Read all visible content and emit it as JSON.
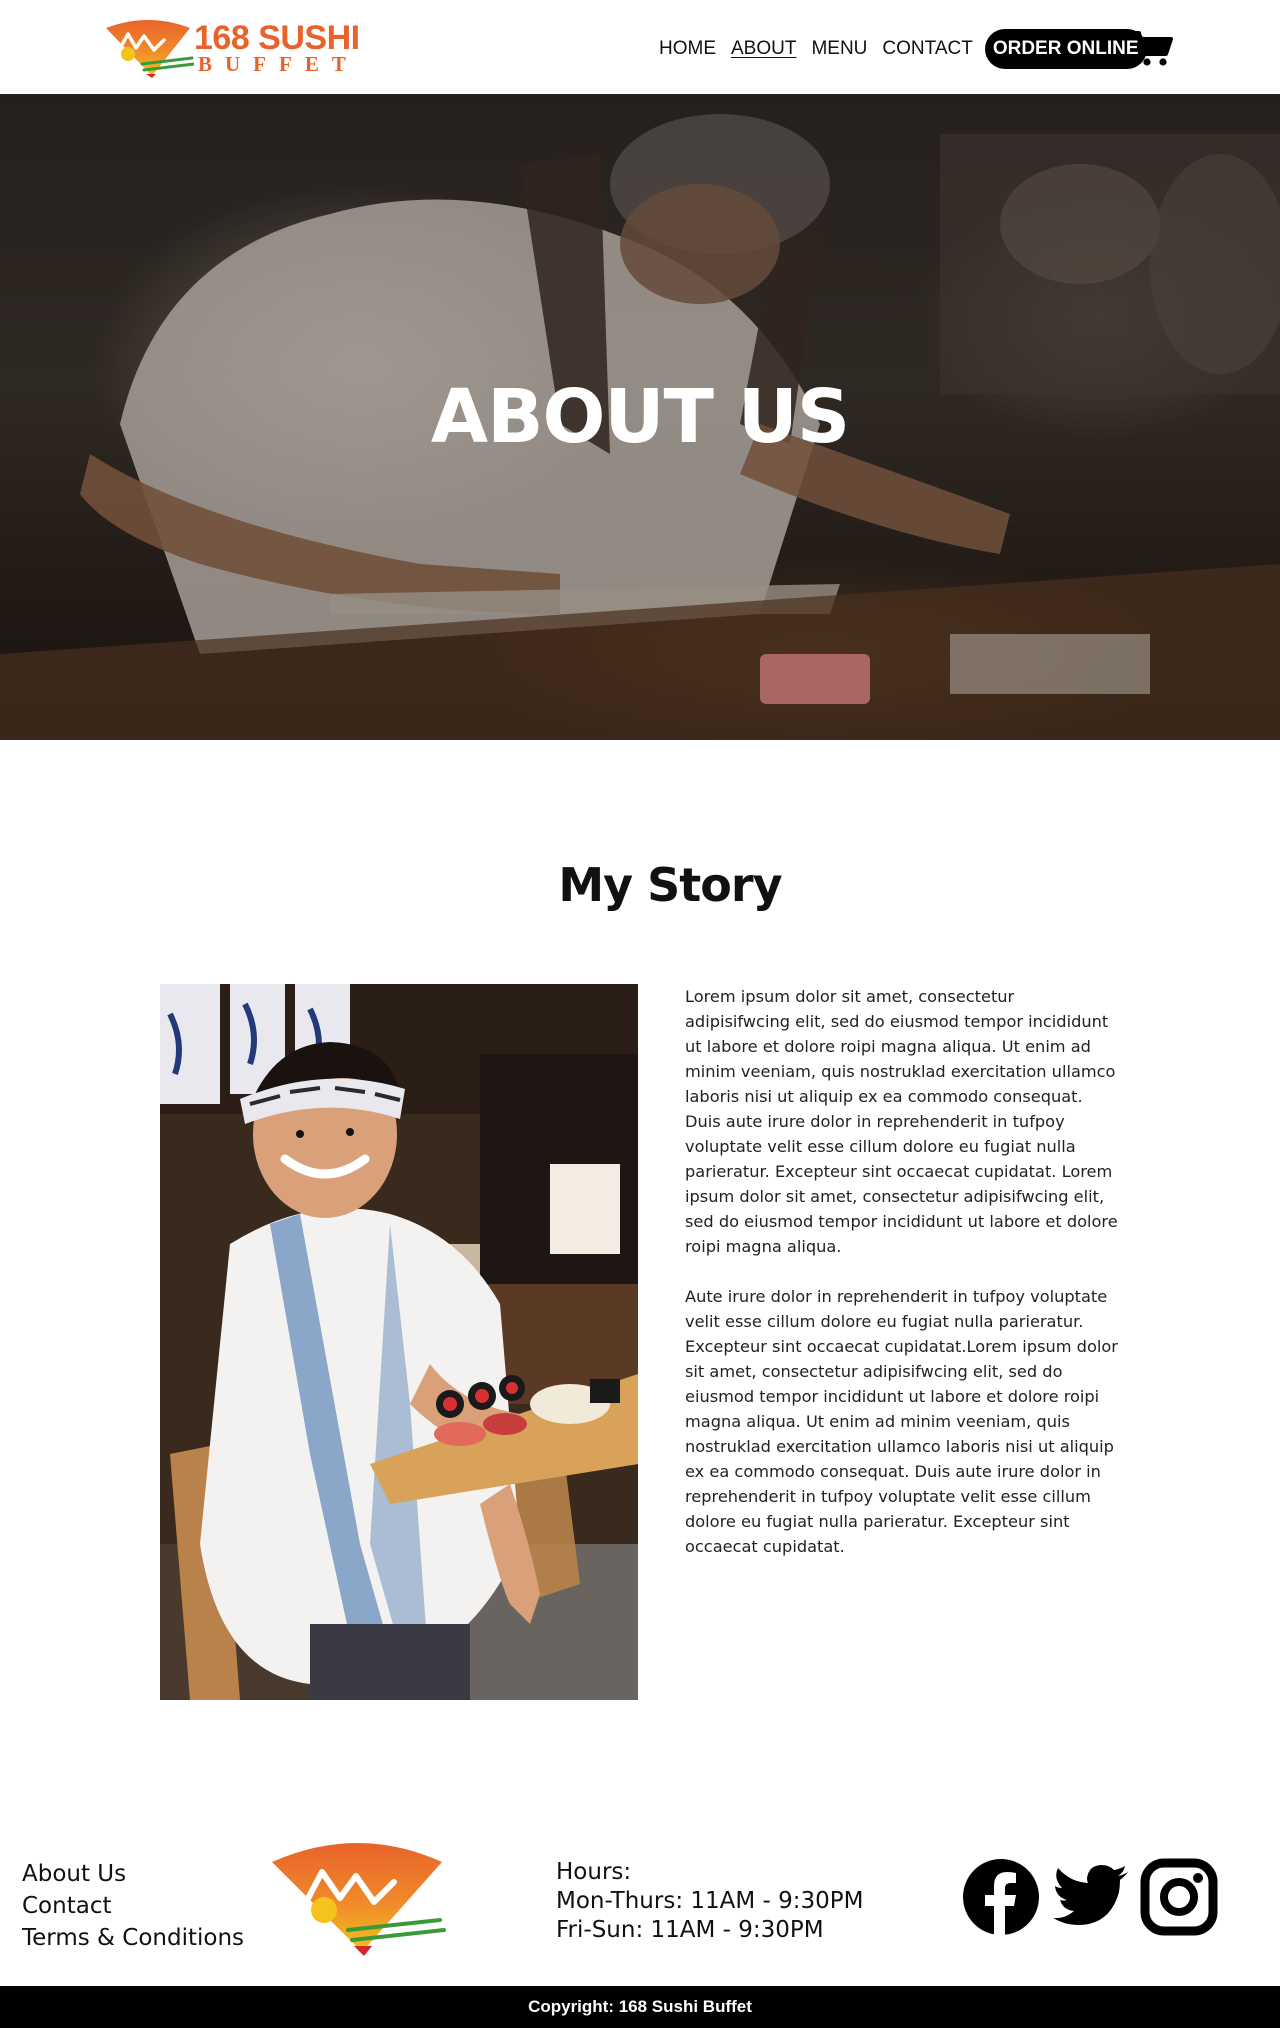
{
  "brand": {
    "name_line1": "168 SUSHI",
    "name_line2": "BUFFET",
    "orange": "#e8632a",
    "yellow": "#f6c21c"
  },
  "nav": {
    "items": [
      {
        "label": "HOME",
        "active": false
      },
      {
        "label": "ABOUT",
        "active": true
      },
      {
        "label": "MENU",
        "active": false
      },
      {
        "label": "CONTACT",
        "active": false
      }
    ],
    "order_label": "ORDER ONLINE",
    "cart_icon": "shopping-cart-icon"
  },
  "hero": {
    "title": "ABOUT US"
  },
  "story": {
    "heading": "My Story",
    "paragraphs": [
      "Lorem ipsum dolor sit amet, consectetur adipisifwcing elit, sed do eiusmod tempor incididunt ut labore et dolore roipi magna aliqua. Ut enim ad minim veeniam, quis nostruklad exercitation ullamco laboris nisi ut aliquip ex ea commodo consequat. Duis aute irure dolor in reprehenderit in tufpoy voluptate velit esse cillum dolore eu fugiat nulla parieratur. Excepteur sint occaecat cupidatat. Lorem ipsum dolor sit amet, consectetur adipisifwcing elit, sed do eiusmod tempor incididunt ut labore et dolore roipi magna aliqua.",
      "Aute irure dolor in reprehenderit in tufpoy voluptate velit esse cillum dolore eu fugiat nulla parieratur. Excepteur sint occaecat cupidatat.Lorem ipsum dolor sit amet, consectetur adipisifwcing elit, sed do eiusmod tempor incididunt ut labore et dolore roipi magna aliqua. Ut enim ad minim veeniam, quis nostruklad exercitation ullamco laboris nisi ut aliquip ex ea commodo consequat. Duis aute irure dolor in reprehenderit in tufpoy voluptate velit esse cillum dolore eu fugiat nulla parieratur. Excepteur sint occaecat cupidatat."
    ]
  },
  "footer": {
    "links": [
      "About Us",
      "Contact",
      "Terms & Conditions"
    ],
    "hours_title": "Hours:",
    "hours_lines": [
      "Mon-Thurs: 11AM - 9:30PM",
      "Fri-Sun: 11AM - 9:30PM"
    ],
    "social_icons": [
      "facebook-icon",
      "twitter-icon",
      "instagram-icon"
    ],
    "copyright": "Copyright: 168 Sushi Buffet"
  }
}
